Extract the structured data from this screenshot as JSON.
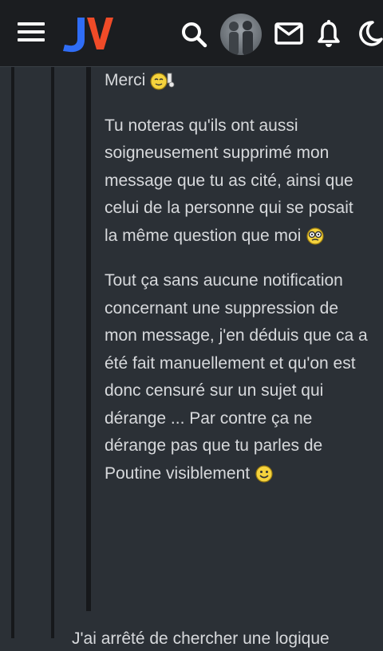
{
  "header": {
    "logo_text": "JV",
    "logo_colors": {
      "j": "#2f6df6",
      "v": "#f04b28"
    },
    "icons": [
      "menu-icon",
      "search-icon",
      "avatar",
      "mail-icon",
      "bell-icon",
      "moon-icon"
    ]
  },
  "post": {
    "quote": {
      "line1": "Merci",
      "para2": "Tu noteras qu'ils ont aussi soigneusement supprimé mon message que tu as cité, ainsi que celui de la personne qui se posait la même question que moi",
      "para3": "Tout ça sans aucune notification concernant une suppression de mon message, j'en déduis que ca a été fait manuellement et qu'on est donc censuré sur un sujet qui dérange ... Par contre ça ne dérange pas que tu parles de Poutine visiblement"
    },
    "next_text": "J'ai arrêté de chercher une logique"
  },
  "colors": {
    "background": "#2b3036",
    "topbar": "#1b1d20",
    "text": "#d7d9dc",
    "rail": "#16181b"
  }
}
